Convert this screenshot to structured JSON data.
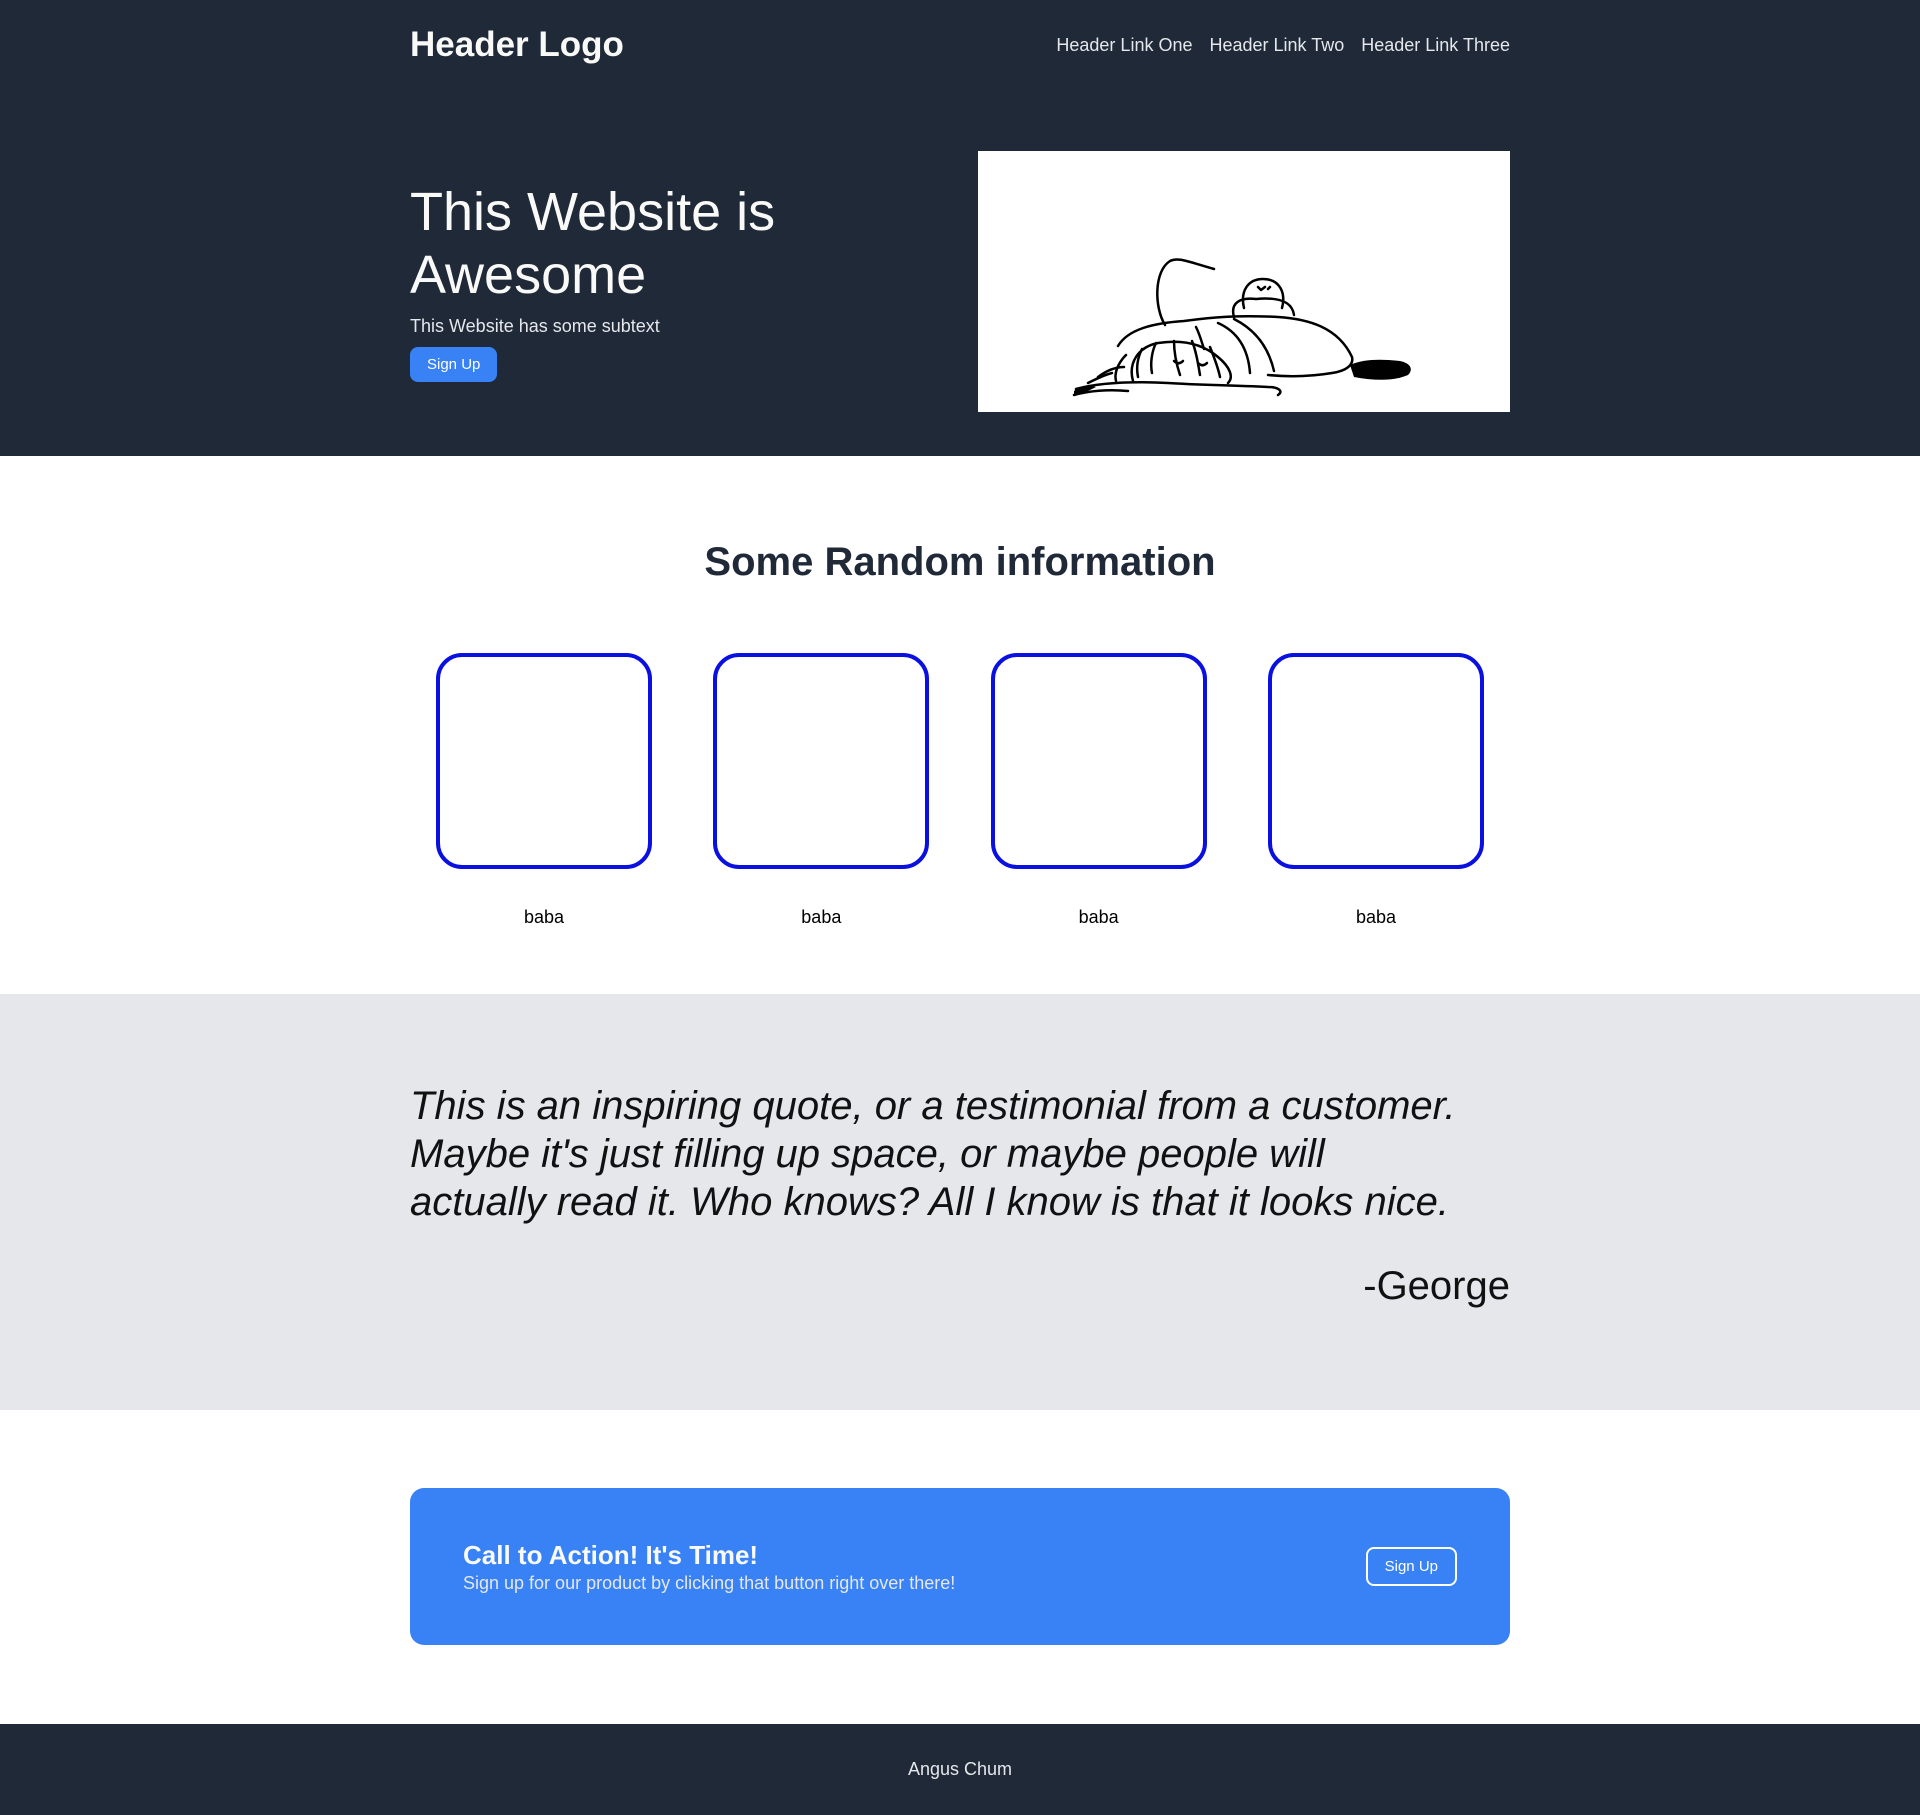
{
  "header": {
    "logo": "Header Logo",
    "links": [
      "Header Link One",
      "Header Link Two",
      "Header Link Three"
    ]
  },
  "hero": {
    "title": "This Website is Awesome",
    "subtext": "This Website has some subtext",
    "button_label": "Sign Up"
  },
  "info": {
    "title": "Some Random information",
    "cards": [
      {
        "label": "baba"
      },
      {
        "label": "baba"
      },
      {
        "label": "baba"
      },
      {
        "label": "baba"
      }
    ]
  },
  "quote": {
    "text": "This is an inspiring quote, or a testimonial from a customer. Maybe it's just filling up space, or maybe people will actually read it. Who knows? All I know is that it looks nice.",
    "author": "-George"
  },
  "cta": {
    "title": "Call to Action! It's Time!",
    "subtext": "Sign up for our product by clicking that button right over there!",
    "button_label": "Sign Up"
  },
  "footer": {
    "text": "Angus Chum"
  },
  "colors": {
    "dark": "#1f2937",
    "accent": "#3882f6",
    "card_border": "#0a10e0",
    "quote_bg": "#e5e7eb"
  }
}
